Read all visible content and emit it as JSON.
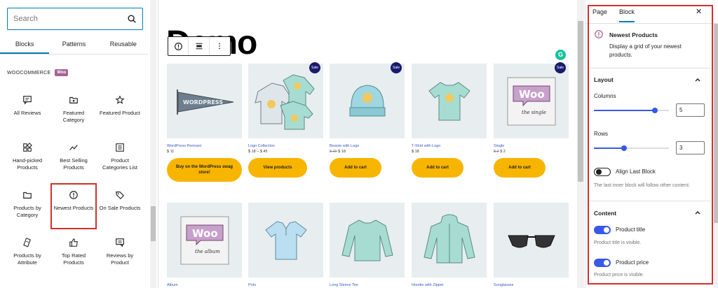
{
  "inserter": {
    "search_placeholder": "Search",
    "tabs": [
      "Blocks",
      "Patterns",
      "Reusable"
    ],
    "section_label": "WOOCOMMERCE",
    "section_badge": "Woo",
    "blocks": [
      {
        "label": "All Reviews",
        "icon": "comment-icon"
      },
      {
        "label": "Featured Category",
        "icon": "folder-star-icon"
      },
      {
        "label": "Featured Product",
        "icon": "star-icon"
      },
      {
        "label": "Hand-picked Products",
        "icon": "grid-icon"
      },
      {
        "label": "Best Selling Products",
        "icon": "trend-icon"
      },
      {
        "label": "Product Categories List",
        "icon": "list-icon"
      },
      {
        "label": "Products by Category",
        "icon": "folder-icon"
      },
      {
        "label": "Newest Products",
        "icon": "exclamation-icon"
      },
      {
        "label": "On Sale Products",
        "icon": "tag-icon"
      },
      {
        "label": "Products by Attribute",
        "icon": "attribute-icon"
      },
      {
        "label": "Top Rated Products",
        "icon": "thumbs-up-icon"
      },
      {
        "label": "Reviews by Product",
        "icon": "comment-box-icon"
      }
    ]
  },
  "canvas": {
    "title": "Demo",
    "sale_badge": "Sale",
    "products": [
      {
        "name": "WordPress Pennant",
        "price": "$ 11",
        "old_price": "",
        "button": "Buy on the WordPress swag store!",
        "sale": false,
        "image": "pennant"
      },
      {
        "name": "Logo Collection",
        "price": "$ 18 – $ 45",
        "old_price": "",
        "button": "View products",
        "sale": true,
        "image": "hoodies"
      },
      {
        "name": "Beanie with Logo",
        "price": "$ 18",
        "old_price": "$ 20",
        "button": "Add to cart",
        "sale": true,
        "image": "beanie"
      },
      {
        "name": "T-Shirt with Logo",
        "price": "$ 18",
        "old_price": "",
        "button": "Add to cart",
        "sale": false,
        "image": "tshirt"
      },
      {
        "name": "Single",
        "price": "$ 2",
        "old_price": "$ 3",
        "button": "Add to cart",
        "sale": true,
        "image": "woo-single"
      },
      {
        "name": "Album",
        "price": "",
        "old_price": "",
        "button": "",
        "sale": false,
        "image": "woo-album"
      },
      {
        "name": "Polo",
        "price": "",
        "old_price": "",
        "button": "",
        "sale": false,
        "image": "polo"
      },
      {
        "name": "Long Sleeve Tee",
        "price": "",
        "old_price": "",
        "button": "",
        "sale": false,
        "image": "longsleeve"
      },
      {
        "name": "Hoodie with Zipper",
        "price": "",
        "old_price": "",
        "button": "",
        "sale": false,
        "image": "hoodie-zip"
      },
      {
        "name": "Sunglasses",
        "price": "",
        "old_price": "",
        "button": "",
        "sale": false,
        "image": "sunglasses"
      }
    ]
  },
  "sidebar": {
    "tabs": [
      "Page",
      "Block"
    ],
    "active_tab": "Block",
    "close_icon": "close-icon",
    "block_name": "Newest Products",
    "block_desc": "Display a grid of your newest products.",
    "layout": {
      "title": "Layout",
      "columns_label": "Columns",
      "columns": 5,
      "columns_level": 0.81,
      "rows_label": "Rows",
      "rows": 3,
      "rows_level": 0.4,
      "align_label": "Align Last Block",
      "align_on": false,
      "align_help": "The last inner block will follow other content."
    },
    "content": {
      "title": "Content",
      "product_title_label": "Product title",
      "product_title_help": "Product title is visible.",
      "product_price_label": "Product price",
      "product_price_help": "Product price is visible."
    }
  },
  "colors": {
    "accent": "#007cba",
    "toggle_on": "#3858e9",
    "button": "#f7b500",
    "highlight": "#d32f2f",
    "woo": "#a46497"
  }
}
